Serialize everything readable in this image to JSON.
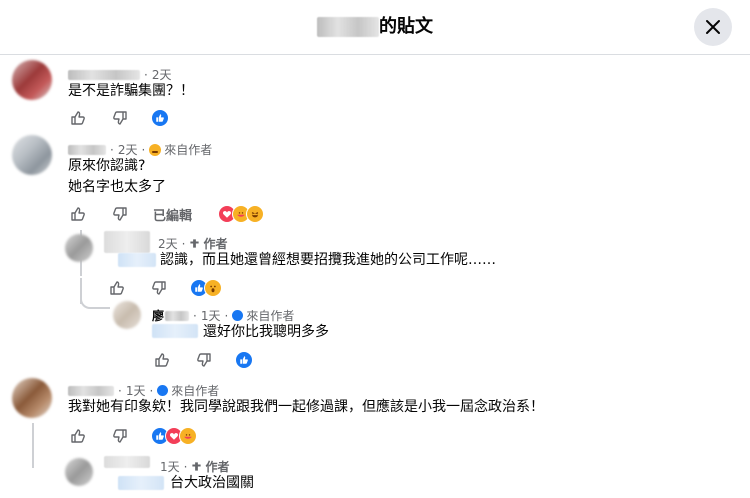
{
  "header": {
    "title_suffix": "的貼文"
  },
  "comments": [
    {
      "time": "2天",
      "text": "是不是詐騙集團？！"
    },
    {
      "time": "2天",
      "badge": "來自作者",
      "lines": [
        "原來你認識?",
        "她名字也太多了"
      ],
      "edited": "已編輯"
    },
    {
      "time": "2天",
      "badge": "作者",
      "text": "認識，而且她還曾經想要招攬我進她的公司工作呢……"
    },
    {
      "name": "廖",
      "time": "1天",
      "badge": "來自作者",
      "text": "還好你比我聰明多多"
    },
    {
      "time": "1天",
      "badge": "來自作者",
      "text": "我對她有印象欸！我同學說跟我們一起修過課，但應該是小我一屆念政治系！"
    },
    {
      "time": "1天",
      "badge": "作者",
      "text": "台大政治國關"
    }
  ],
  "icons": {
    "like": "like-icon",
    "dislike": "dislike-icon",
    "close": "close-icon",
    "author": "author-badge-icon"
  },
  "colors": {
    "like_blue": "#1877f2",
    "love_red": "#f33e58",
    "haha_yellow": "#f7b125",
    "meta_gray": "#65676b"
  }
}
